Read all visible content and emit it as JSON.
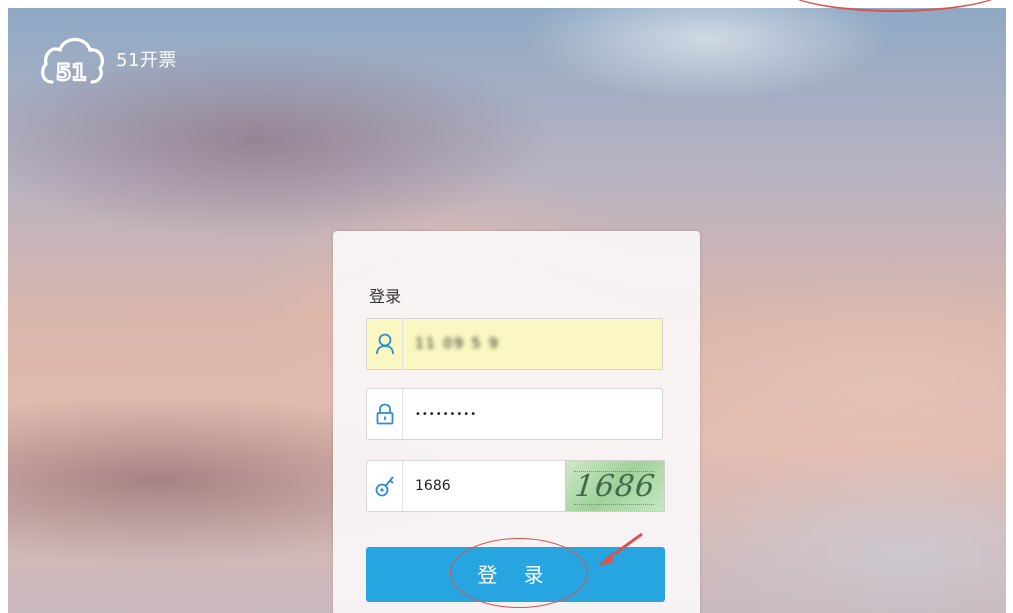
{
  "app": {
    "logo_text": "51开票"
  },
  "login": {
    "title": "登录",
    "username_value": "11 09 5 9",
    "password_value": "•••••••••",
    "captcha_input_value": "1686",
    "captcha_image_text": "1686",
    "submit_label": "登 录"
  },
  "icons": {
    "logo": "cloud-51-icon",
    "user": "user-icon",
    "password": "lock-icon",
    "captcha": "key-icon"
  },
  "colors": {
    "accent": "#27a5e0",
    "autofill_bg": "#faf7c2",
    "annotation": "#d9534f"
  }
}
